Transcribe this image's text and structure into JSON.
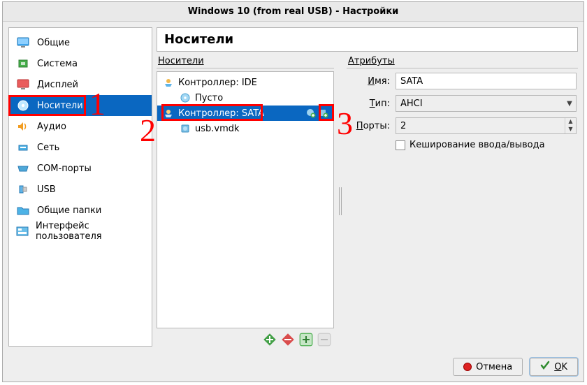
{
  "window": {
    "title": "Windows 10 (from real USB) - Настройки"
  },
  "sidebar": {
    "items": [
      {
        "label": "Общие"
      },
      {
        "label": "Система"
      },
      {
        "label": "Дисплей"
      },
      {
        "label": "Носители"
      },
      {
        "label": "Аудио"
      },
      {
        "label": "Сеть"
      },
      {
        "label": "COM-порты"
      },
      {
        "label": "USB"
      },
      {
        "label": "Общие папки"
      },
      {
        "label": "Интерфейс пользователя"
      }
    ]
  },
  "page": {
    "title": "Носители"
  },
  "tree": {
    "group_label": "Носители",
    "controller_ide": "Контроллер: IDE",
    "ide_child": "Пусто",
    "controller_sata": "Контроллер: SATA",
    "sata_child": "usb.vmdk"
  },
  "attributes": {
    "group_label": "Атрибуты",
    "name_label_ul": "И",
    "name_label_rest": "мя:",
    "name_value": "SATA",
    "type_label_ul": "Т",
    "type_label_rest": "ип:",
    "type_value": "AHCI",
    "ports_label_ul": "П",
    "ports_label_rest": "орты:",
    "ports_value": "2",
    "cache_label": "Кеширование ввода/вывода"
  },
  "buttons": {
    "cancel": "Отмена",
    "ok_ul": "O",
    "ok_rest": "K"
  }
}
